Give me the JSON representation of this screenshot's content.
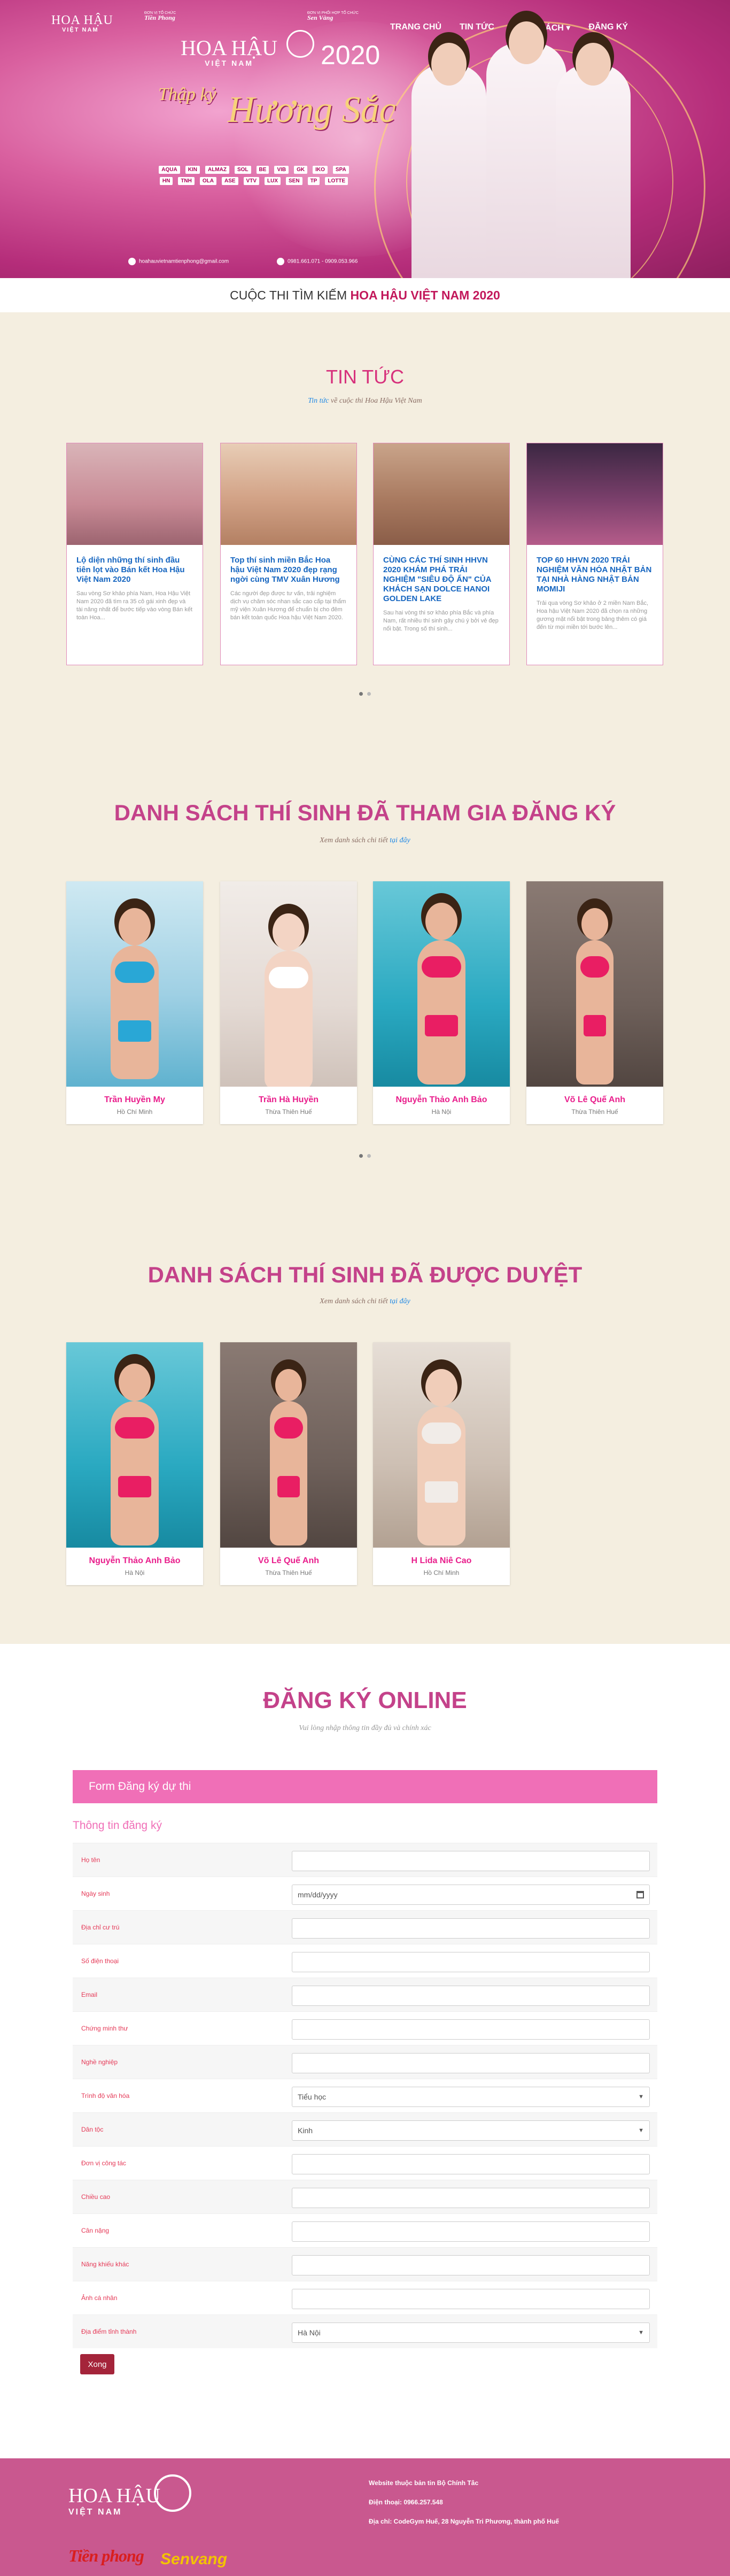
{
  "header": {
    "brand_line1": "HOA HẬU",
    "brand_line2": "VIỆT NAM",
    "organizer_label": "ĐƠN VỊ TỔ CHỨC",
    "organizer_name": "Tiền Phong",
    "coorganizer_label": "ĐƠN VỊ PHỐI HỢP TỔ CHỨC",
    "coorganizer_name": "Sen Vàng",
    "nav": [
      {
        "label": "TRANG CHỦ"
      },
      {
        "label": "TIN TỨC"
      },
      {
        "label": "DANH SÁCH ▾"
      },
      {
        "label": "ĐĂNG KÝ"
      }
    ]
  },
  "hero": {
    "logo_line1": "HOA HẬU",
    "logo_line2": "VIỆT NAM",
    "year": "2020",
    "slogan_small": "Thập kỷ",
    "slogan_big": "Hương Sắc",
    "sponsors": [
      "AQUA",
      "KIN",
      "ALMAZ",
      "SOL",
      "BE",
      "VIB",
      "GK",
      "IKO",
      "SPA",
      "HN",
      "TNH",
      "OLA",
      "ASE",
      "VTV",
      "LUX",
      "SEN",
      "TP",
      "LOTTE"
    ],
    "email": "hoahauvietnamtienphong@gmail.com",
    "hotline": "0981.661.071 - 0909.053.966"
  },
  "tagline": {
    "prefix": "CUỘC THI TÌM KIẾM ",
    "highlight": "HOA HẬU VIỆT NAM 2020"
  },
  "news": {
    "title": "TIN TỨC",
    "subtitle_link": "Tin tức",
    "subtitle_rest": " về cuộc thi Hoa Hậu Việt Nam",
    "items": [
      {
        "title": "Lộ diện những thí sinh đầu tiên lọt vào Bán kết Hoa Hậu Việt Nam 2020",
        "excerpt": "Sau vòng Sơ khảo phía Nam, Hoa Hậu Việt Nam 2020 đã tìm ra 35 cô gái xinh đẹp và tài năng nhất để bước tiếp vào vòng Bán kết toàn Hoa..."
      },
      {
        "title": "Top thí sinh miền Bắc Hoa hậu Việt Nam 2020 đẹp rạng ngời cùng TMV Xuân Hương",
        "excerpt": "Các người đẹp được tư vấn, trải nghiệm dịch vụ chăm sóc nhan sắc cao cấp tại thẩm mỹ viện Xuân Hương để chuẩn bị cho đêm bán kết toàn quốc Hoa hậu Việt Nam 2020."
      },
      {
        "title": "CÙNG CÁC THÍ SINH HHVN 2020 KHÁM PHÁ TRẢI NGHIỆM \"SIÊU ĐỘ ẨN\" CỦA KHÁCH SẠN DOLCE HANOI GOLDEN LAKE",
        "excerpt": "Sau hai vòng thi sơ khảo phía Bắc và phía Nam, rất nhiều thí sinh gây chú ý bởi vẻ đẹp nổi bật. Trong số thí sinh..."
      },
      {
        "title": "TOP 60 HHVN 2020 TRẢI NGHIỆM VĂN HÓA NHẬT BẢN TẠI NHÀ HÀNG NHẬT BẢN MOMIJI",
        "excerpt": "Trải qua vòng Sơ khảo ở 2 miền Nam Bắc, Hoa hậu Việt Nam 2020 đã chọn ra những gương mặt nổi bật trong bảng thêm có giá đến từ mọi miền tới bước lên..."
      }
    ]
  },
  "registered": {
    "title": "DANH SÁCH THÍ SINH ĐÃ THAM GIA ĐĂNG KÝ",
    "subtitle_prefix": "Xem danh sách chi tiết ",
    "subtitle_link": "tại đây",
    "items": [
      {
        "name": "Trần Huyền My",
        "place": "Hồ Chí Minh"
      },
      {
        "name": "Trần Hà Huyền",
        "place": "Thừa Thiên Huế"
      },
      {
        "name": "Nguyễn Thảo Anh Bảo",
        "place": "Hà Nội"
      },
      {
        "name": "Võ Lê Quế Anh",
        "place": "Thừa Thiên Huế"
      }
    ]
  },
  "approved": {
    "title": "DANH SÁCH THÍ SINH ĐÃ ĐƯỢC DUYỆT",
    "subtitle_prefix": "Xem danh sách chi tiết ",
    "subtitle_link": "tại đây",
    "items": [
      {
        "name": "Nguyễn Thảo Anh Bảo",
        "place": "Hà Nội"
      },
      {
        "name": "Võ Lê Quế Anh",
        "place": "Thừa Thiên Huế"
      },
      {
        "name": "H Lida Niê Cao",
        "place": "Hồ Chí Minh"
      }
    ]
  },
  "form": {
    "title": "ĐĂNG KÝ ONLINE",
    "subtitle": "Vui lòng nhập thông tin đầy đủ và chính xác",
    "header": "Form Đăng ký dự thi",
    "section": "Thông tin đăng ký",
    "fields": [
      {
        "label": "Họ tên",
        "value": ""
      },
      {
        "label": "Ngày sinh",
        "value": "mm/dd/yyyy"
      },
      {
        "label": "Địa chỉ cư trú",
        "value": ""
      },
      {
        "label": "Số điện thoại",
        "value": ""
      },
      {
        "label": "Email",
        "value": ""
      },
      {
        "label": "Chứng minh thư",
        "value": ""
      },
      {
        "label": "Nghề nghiệp",
        "value": ""
      },
      {
        "label": "Trình độ văn hóa",
        "value": "Tiểu học"
      },
      {
        "label": "Dân tộc",
        "value": "Kinh"
      },
      {
        "label": "Đơn vị công tác",
        "value": ""
      },
      {
        "label": "Chiều cao",
        "value": ""
      },
      {
        "label": "Cân nặng",
        "value": ""
      },
      {
        "label": "Năng khiếu khác",
        "value": ""
      },
      {
        "label": "Ảnh cá nhân",
        "value": ""
      },
      {
        "label": "Địa điểm tỉnh thành",
        "value": "Hà Nội"
      }
    ],
    "submit_label": "Xong"
  },
  "footer": {
    "brand_line1": "HOA HẬU",
    "brand_line2": "VIỆT NAM",
    "partner1": "Tiền phong",
    "partner2": "Senvang",
    "website": "Website thuộc bản tin Bộ Chính Tâc",
    "phone": "Điện thoại: 0966.257.548",
    "address": "Địa chỉ: CodeGym Huế, 28 Nguyễn Tri Phương, thành phố Huế"
  },
  "colors": {
    "hero_pink": "#c23a84",
    "accent_pink": "#e91e8c",
    "form_header": "#f06fb7",
    "cream_bg": "#f4eee0",
    "footer_pink": "#c9588f",
    "submit": "#a4243a"
  }
}
